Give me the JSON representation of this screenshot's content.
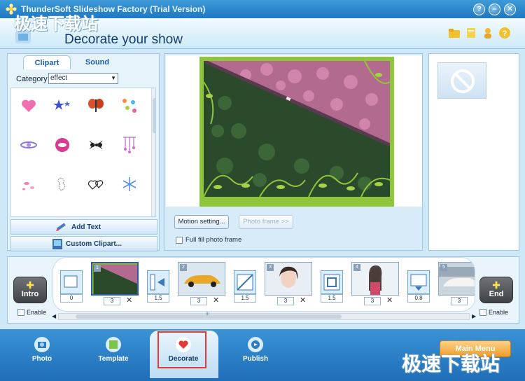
{
  "window": {
    "title": "ThunderSoft Slideshow Factory (Trial Version)"
  },
  "header": {
    "title": "Decorate your show",
    "watermark": "极速下载站"
  },
  "left_panel": {
    "tabs": [
      "Clipart",
      "Sound"
    ],
    "category_label": "Category",
    "category_value": "effect",
    "add_text_label": "Add Text",
    "custom_clipart_label": "Custom Clipart..."
  },
  "preview": {
    "motion_button": "Motion setting...",
    "photo_frame_button": "Photo frame >>",
    "full_fill_label": "Full fill photo frame"
  },
  "timeline": {
    "intro_label": "Intro",
    "end_label": "End",
    "enable_label": "Enable",
    "scroll_grip": "III",
    "transitions": [
      "0",
      "1.5",
      "1.5",
      "1.5",
      "0.8"
    ],
    "slides": [
      {
        "number": "1",
        "duration": "3"
      },
      {
        "number": "2",
        "duration": "3"
      },
      {
        "number": "3",
        "duration": "3"
      },
      {
        "number": "4",
        "duration": "3"
      },
      {
        "number": "5",
        "duration": "3"
      }
    ]
  },
  "bottom_nav": {
    "items": [
      "Photo",
      "Template",
      "Decorate",
      "Publish"
    ],
    "active": "Decorate",
    "main_menu": "Main Menu",
    "watermark": "极速下载站"
  },
  "colors": {
    "accent": "#1f78c2",
    "frame_green": "#8fc53a",
    "highlight_red": "#e23a3a"
  }
}
